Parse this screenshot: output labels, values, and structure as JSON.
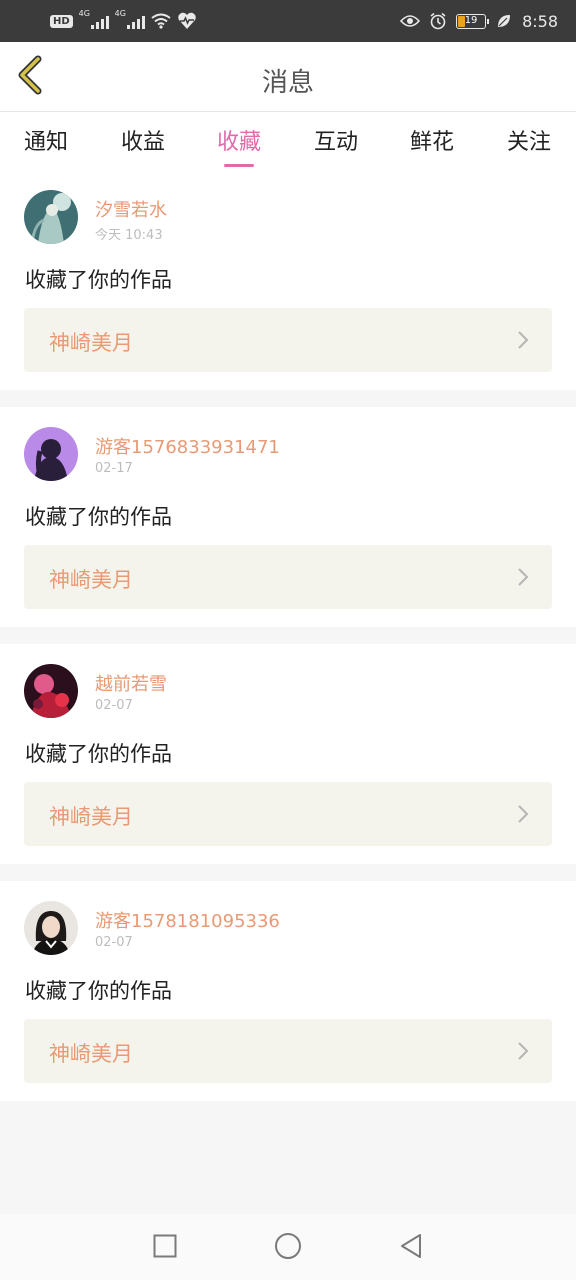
{
  "status_bar": {
    "network_badge": "HD",
    "signal_1_label": "4G",
    "signal_2_label": "4G",
    "battery_level": "19",
    "time": "8:58",
    "icons": [
      "hd-icon",
      "signal-icon",
      "signal-icon",
      "wifi-icon",
      "heart-pulse-icon",
      "eye-icon",
      "alarm-icon",
      "battery-icon",
      "leaf-icon"
    ],
    "battery_color": "#f0a020"
  },
  "header": {
    "title": "消息",
    "back_icon": "chevron-left-icon",
    "back_color": "#d4c24a"
  },
  "tabs": [
    {
      "label": "通知",
      "active": false
    },
    {
      "label": "收益",
      "active": false
    },
    {
      "label": "收藏",
      "active": true
    },
    {
      "label": "互动",
      "active": false
    },
    {
      "label": "鲜花",
      "active": false
    },
    {
      "label": "关注",
      "active": false
    }
  ],
  "accent_color": "#e16aa8",
  "name_color": "#e89a74",
  "messages": [
    {
      "user": "汐雪若水",
      "time": "今天 10:43",
      "action": "收藏了你的作品",
      "work": "神崎美月"
    },
    {
      "user": "游客1576833931471",
      "time": "02-17",
      "action": "收藏了你的作品",
      "work": "神崎美月"
    },
    {
      "user": "越前若雪",
      "time": "02-07",
      "action": "收藏了你的作品",
      "work": "神崎美月"
    },
    {
      "user": "游客1578181095336",
      "time": "02-07",
      "action": "收藏了你的作品",
      "work": "神崎美月"
    }
  ],
  "nav_bar": {
    "icons": [
      "recents-square-icon",
      "home-circle-icon",
      "back-triangle-icon"
    ]
  }
}
